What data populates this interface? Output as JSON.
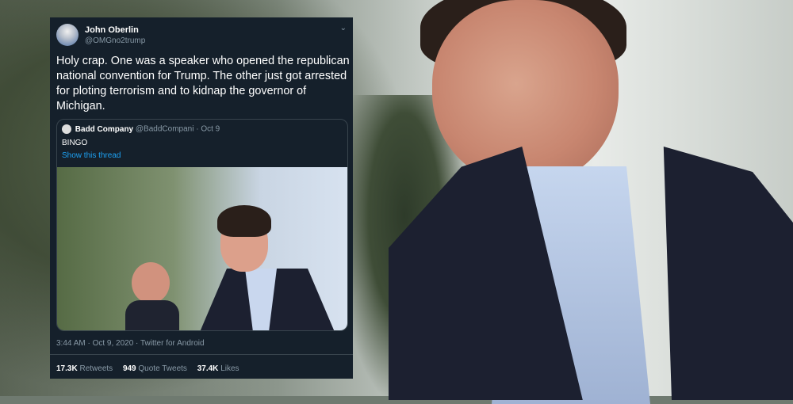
{
  "tweet": {
    "author_name": "John Oberlin",
    "author_handle": "@OMGno2trump",
    "text": "Holy crap.  One was a speaker who opened the republican national convention for Trump.  The other just got arrested for ploting terrorism and to kidnap the governor of Michigan.",
    "quote": {
      "name": "Badd Company",
      "handle": "@BaddCompani",
      "separator": " · ",
      "date": "Oct 9",
      "text": "BINGO",
      "link": "Show this thread"
    },
    "timestamp": "3:44 AM · Oct 9, 2020 · Twitter for Android",
    "stats": {
      "retweets_count": "17.3K",
      "retweets_label": "Retweets",
      "quotes_count": "949",
      "quotes_label": "Quote Tweets",
      "likes_count": "37.4K",
      "likes_label": "Likes"
    }
  },
  "colors": {
    "card_bg": "#15202b",
    "link": "#1da1f2",
    "muted": "#8899a6"
  },
  "icons": [
    "avatar",
    "chevron-down-icon"
  ]
}
